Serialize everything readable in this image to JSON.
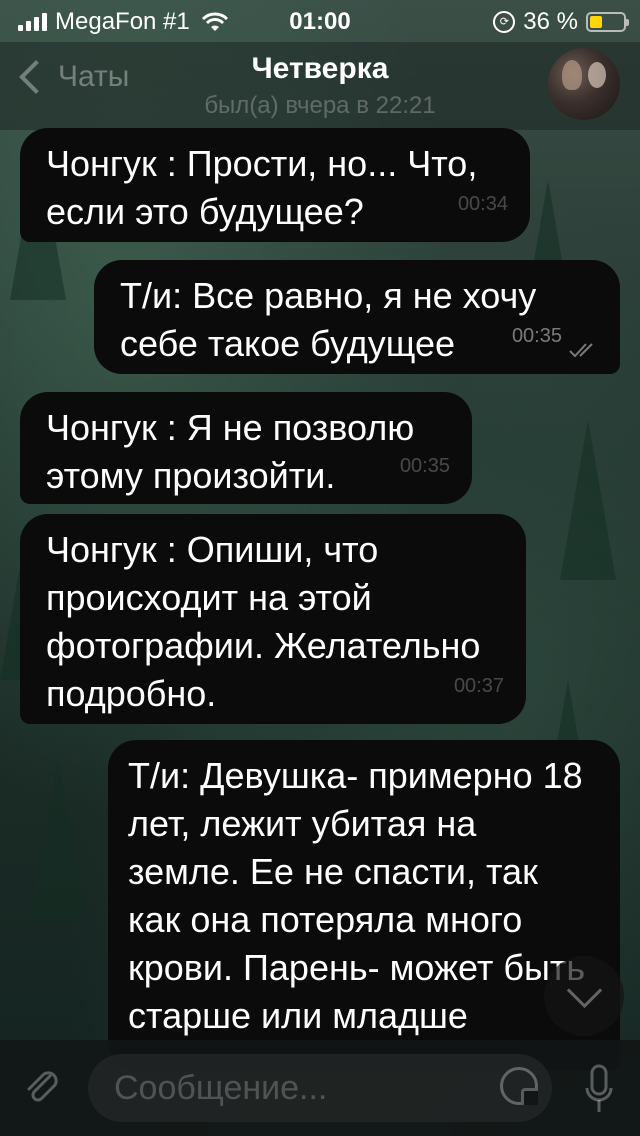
{
  "status_bar": {
    "carrier": "MegaFon #1",
    "time": "01:00",
    "battery_text": "36 %",
    "battery_level": 0.36
  },
  "nav": {
    "back_label": "Чаты",
    "title": "Четверка",
    "subtitle": "был(а) вчера в 22:21"
  },
  "messages": [
    {
      "direction": "in",
      "text": "Чонгук : Прости, но... Что, если это будущее?",
      "time": "00:34"
    },
    {
      "direction": "out",
      "text": "Т/и: Все равно, я не хочу себе такое будущее",
      "time": "00:35"
    },
    {
      "direction": "in",
      "text": "Чонгук : Я не позволю этому произойти.",
      "time": "00:35"
    },
    {
      "direction": "in",
      "text": "Чонгук : Опиши, что происходит на этой фотографии. Желательно подробно.",
      "time": "00:37"
    },
    {
      "direction": "out",
      "text": "Т/и: Девушка- примерно 18 лет, лежит убитая на земле. Ее не спасти, так как она потеряла много крови. Парень- может быть старше или младше",
      "time": ""
    }
  ],
  "input": {
    "placeholder": "Сообщение..."
  }
}
